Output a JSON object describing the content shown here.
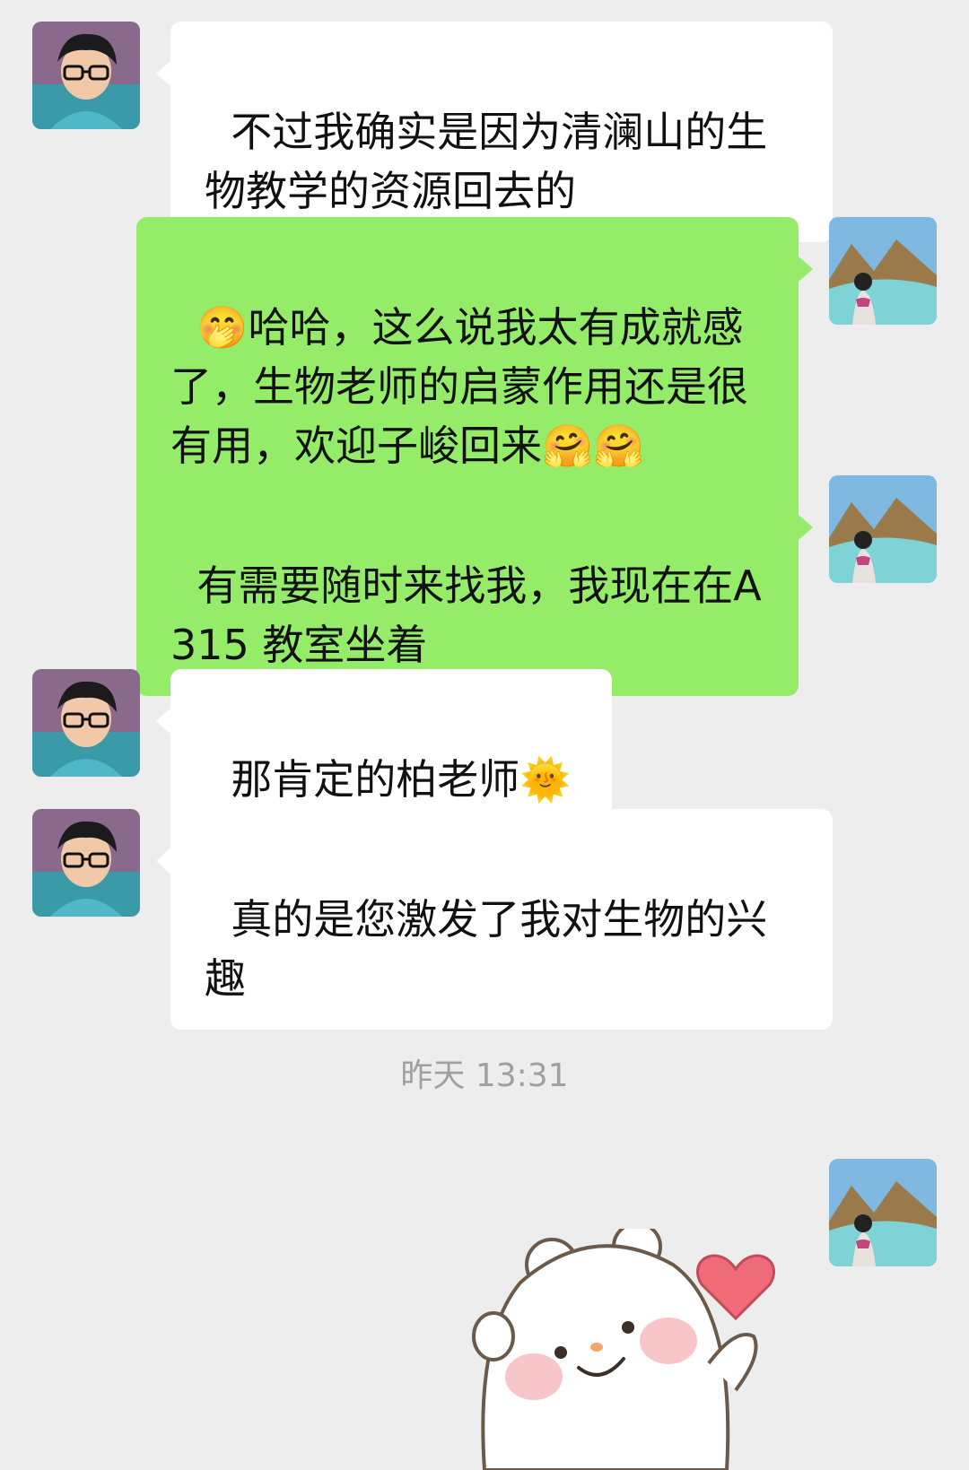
{
  "messages": [
    {
      "side": "in",
      "text": "不过我确实是因为清澜山的生物教学的资源回去的"
    },
    {
      "side": "out",
      "text": "🤭哈哈，这么说我太有成就感了，生物老师的启蒙作用还是很有用，欢迎子峻回来🤗🤗"
    },
    {
      "side": "out",
      "text": "有需要随时来找我，我现在在A315 教室坐着"
    },
    {
      "side": "in",
      "text": "那肯定的柏老师🌞"
    },
    {
      "side": "in",
      "text": "真的是您激发了我对生物的兴趣"
    }
  ],
  "timestamp": "昨天 13:31",
  "sticker": {
    "icon": "bear-waving-heart-sticker"
  },
  "avatars": {
    "contact": "boy-glasses-avatar",
    "self": "mountain-lake-avatar"
  },
  "colors": {
    "background": "#ededed",
    "incoming_bubble": "#ffffff",
    "outgoing_bubble": "#95ec69",
    "timestamp": "#a0a0a0"
  }
}
